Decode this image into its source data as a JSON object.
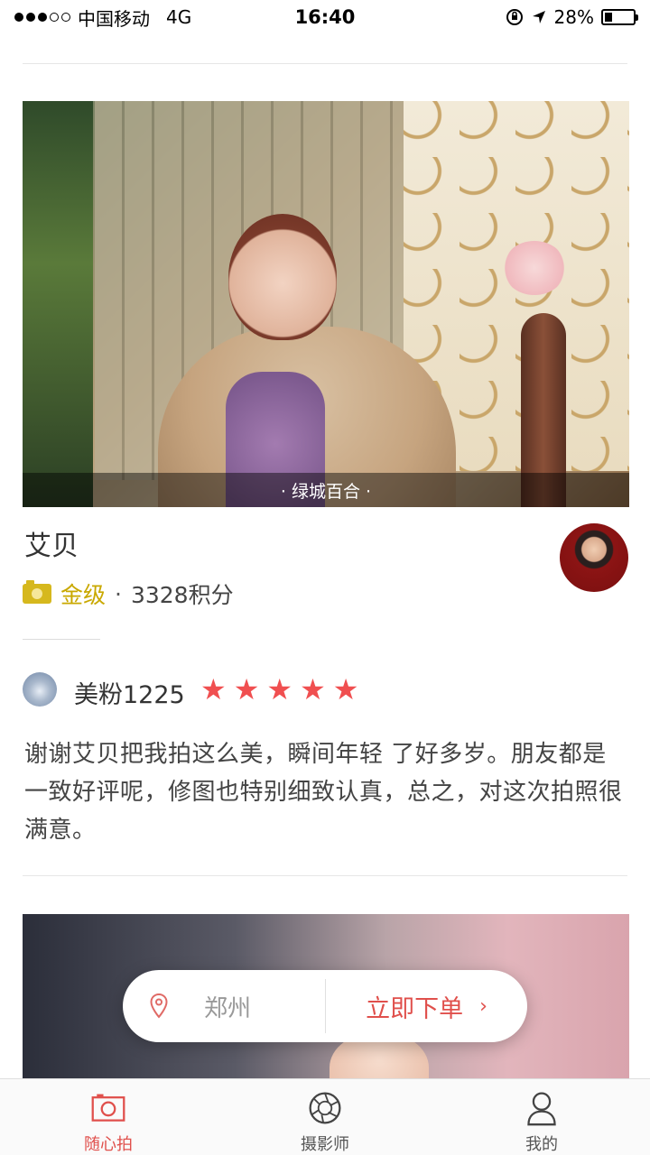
{
  "status_bar": {
    "carrier": "中国移动",
    "network": "4G",
    "time": "16:40",
    "battery": "28%",
    "battery_level": 0.28,
    "signal_bars_filled": 3,
    "signal_bars_total": 5
  },
  "cover": {
    "caption": "· 绿城百合 ·"
  },
  "photographer": {
    "name": "艾贝",
    "level": "金级",
    "separator": "·",
    "score": "3328积分",
    "level_icon": "camera-icon"
  },
  "review": {
    "reviewer": "美粉1225",
    "rating": 5,
    "rating_max": 5,
    "text": "谢谢艾贝把我拍这么美，瞬间年轻 了好多岁。朋友都是一致好评呢，修图也特别细致认真，总之，对这次拍照很满意。"
  },
  "action": {
    "city": "郑州",
    "order_label": "立即下单",
    "order_chevron": "›",
    "location_icon": "location-pin-icon"
  },
  "tabs": [
    {
      "label": "随心拍",
      "icon": "camera-frame-icon",
      "active": true
    },
    {
      "label": "摄影师",
      "icon": "aperture-icon",
      "active": false
    },
    {
      "label": "我的",
      "icon": "person-icon",
      "active": false
    }
  ],
  "colors": {
    "accent": "#e0504c",
    "gold": "#c9a800",
    "star": "#f04f50"
  }
}
